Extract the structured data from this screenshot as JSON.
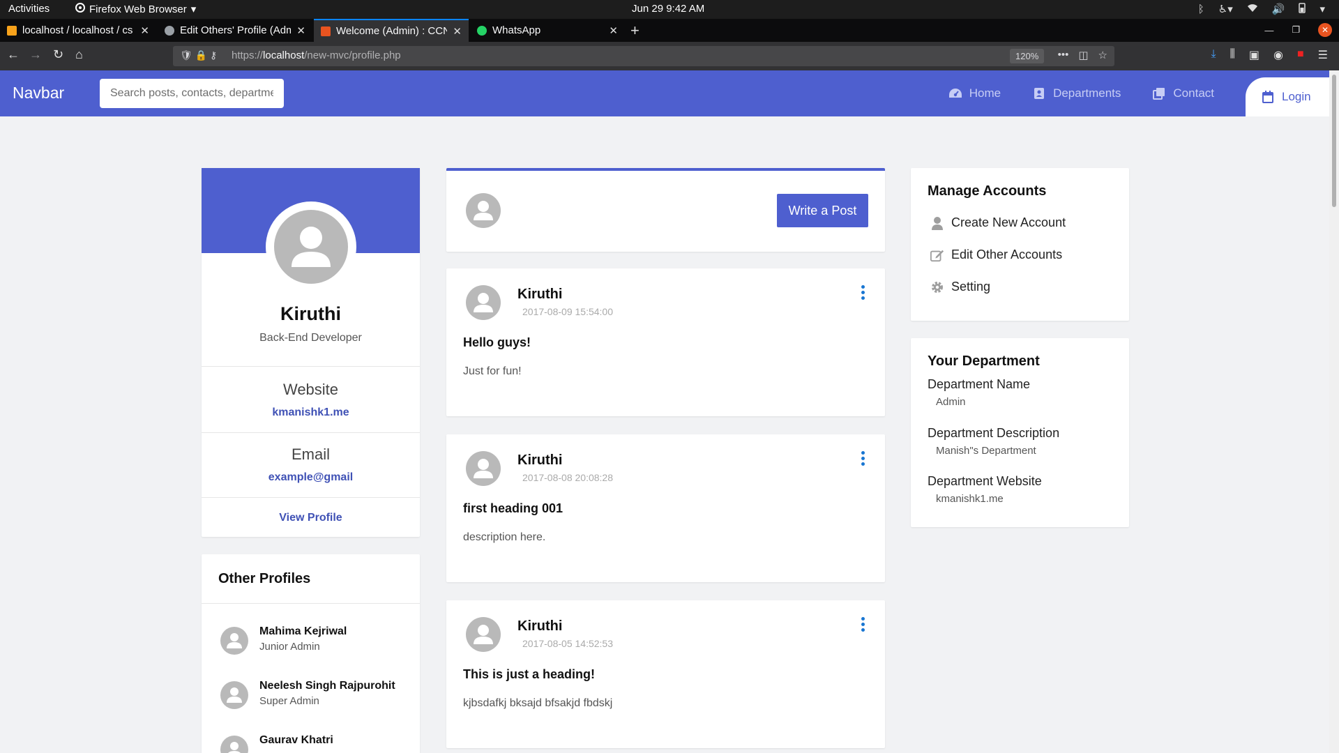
{
  "system_bar": {
    "activities": "Activities",
    "app_menu": "Firefox Web Browser",
    "clock": "Jun 29  9:42 AM"
  },
  "browser": {
    "tabs": [
      {
        "label": "localhost / localhost / cs",
        "active": false,
        "favicon_color": "#f7a21b"
      },
      {
        "label": "Edit Others' Profile (Adm",
        "active": false,
        "favicon_color": "#9aa0a6"
      },
      {
        "label": "Welcome (Admin) : CCNB",
        "active": true,
        "favicon_color": "#e95420"
      },
      {
        "label": "WhatsApp",
        "active": false,
        "favicon_color": "#25d366"
      }
    ],
    "url_prefix": "https://",
    "url_host": "localhost",
    "url_path": "/new-mvc/profile.php",
    "zoom": "120%"
  },
  "navbar": {
    "brand": "Navbar",
    "search_placeholder": "Search posts, contacts, departments",
    "links": {
      "home": "Home",
      "departments": "Departments",
      "contact": "Contact",
      "login": "Login"
    },
    "color": "#4e5fcf"
  },
  "profile": {
    "name": "Kiruthi",
    "role": "Back-End Developer",
    "website_label": "Website",
    "website_value": "kmanishk1.me",
    "email_label": "Email",
    "email_value": "example@gmail",
    "view_profile": "View Profile"
  },
  "other_profiles": {
    "title": "Other Profiles",
    "items": [
      {
        "name": "Mahima Kejriwal",
        "role": "Junior Admin"
      },
      {
        "name": "Neelesh Singh Rajpurohit",
        "role": "Super Admin"
      },
      {
        "name": "Gaurav Khatri",
        "role": ""
      }
    ]
  },
  "write_post": {
    "button": "Write a Post"
  },
  "posts": [
    {
      "author": "Kiruthi",
      "date": "2017-08-09 15:54:00",
      "title": "Hello guys!",
      "description": "Just for fun!"
    },
    {
      "author": "Kiruthi",
      "date": "2017-08-08 20:08:28",
      "title": "first heading 001",
      "description": "description here."
    },
    {
      "author": "Kiruthi",
      "date": "2017-08-05 14:52:53",
      "title": "This is just a heading!",
      "description": "kjbsdafkj bksajd bfsakjd fbdskj"
    }
  ],
  "manage_accounts": {
    "title": "Manage Accounts",
    "items": [
      {
        "label": "Create New Account",
        "icon": "user-icon"
      },
      {
        "label": "Edit Other Accounts",
        "icon": "edit-icon"
      },
      {
        "label": "Setting",
        "icon": "gear-icon"
      }
    ]
  },
  "department": {
    "title": "Your Department",
    "name_label": "Department Name",
    "name_value": "Admin",
    "desc_label": "Department Description",
    "desc_value": "Manish\"s Department",
    "website_label": "Department Website",
    "website_value": "kmanishk1.me"
  }
}
